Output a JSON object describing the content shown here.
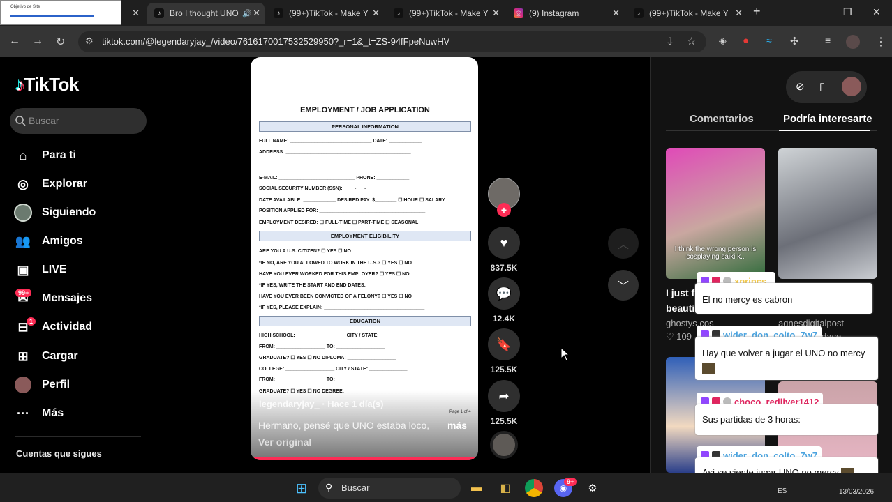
{
  "browser": {
    "tabs": [
      {
        "title": "Objetivo de Site",
        "favicon": "thumbnail-icon"
      },
      {
        "title": "Bro I thought UNO",
        "favicon": "tiktok-icon",
        "active": true
      },
      {
        "title": "(99+)TikTok - Make Y",
        "favicon": "tiktok-icon"
      },
      {
        "title": "(99+)TikTok - Make Y",
        "favicon": "tiktok-icon"
      },
      {
        "title": "(9) Instagram",
        "favicon": "instagram-icon"
      },
      {
        "title": "(99+)TikTok - Make Y",
        "favicon": "tiktok-icon"
      }
    ],
    "url": "tiktok.com/@legendaryjay_/video/7616170017532529950?_r=1&_t=ZS-94fFpeNuwHV"
  },
  "sidebar": {
    "logo": "TikTok",
    "search_placeholder": "Buscar",
    "items": [
      {
        "label": "Para ti",
        "icon": "home-icon"
      },
      {
        "label": "Explorar",
        "icon": "compass-icon"
      },
      {
        "label": "Siguiendo",
        "icon": "following-avatar-icon"
      },
      {
        "label": "Amigos",
        "icon": "friends-icon"
      },
      {
        "label": "LIVE",
        "icon": "live-icon"
      },
      {
        "label": "Mensajes",
        "icon": "messages-icon",
        "badge": "99+"
      },
      {
        "label": "Actividad",
        "icon": "activity-icon",
        "badge": "1"
      },
      {
        "label": "Cargar",
        "icon": "upload-icon"
      },
      {
        "label": "Perfil",
        "icon": "profile-avatar-icon"
      },
      {
        "label": "Más",
        "icon": "more-icon"
      }
    ],
    "following_heading": "Cuentas que sigues"
  },
  "video": {
    "document": {
      "title": "EMPLOYMENT / JOB APPLICATION",
      "sections": [
        {
          "heading": "PERSONAL INFORMATION",
          "lines": [
            "FULL NAME: ______________________________ DATE: ____________",
            "ADDRESS: ______________________________________________",
            "E-MAIL: ____________________________ PHONE: ____________",
            "SOCIAL SECURITY NUMBER (SSN): ____-___-____",
            "DATE AVAILABLE: ____________ DESIRED PAY: $________ ☐ HOUR ☐ SALARY",
            "POSITION APPLIED FOR: _______________________________________",
            "EMPLOYMENT DESIRED: ☐ FULL-TIME ☐ PART-TIME ☐ SEASONAL"
          ]
        },
        {
          "heading": "EMPLOYMENT ELIGIBILITY",
          "lines": [
            "ARE YOU A U.S. CITIZEN? ☐ YES ☐ NO",
            "*IF NO, ARE YOU ALLOWED TO WORK IN THE U.S.? ☐ YES ☐ NO",
            "HAVE YOU EVER WORKED FOR THIS EMPLOYER? ☐ YES ☐ NO",
            "*IF YES, WRITE THE START AND END DATES: ______________________",
            "HAVE YOU EVER BEEN CONVICTED OF A FELONY? ☐ YES ☐ NO",
            "*IF YES, PLEASE EXPLAIN: _____________________________________"
          ]
        },
        {
          "heading": "EDUCATION",
          "lines": [
            "HIGH SCHOOL: __________________ CITY / STATE: ______________",
            "FROM: __________________ TO: __________________",
            "GRADUATE? ☐ YES ☐ NO DIPLOMA: __________________",
            "COLLEGE: __________________ CITY / STATE: ______________",
            "FROM: __________________ TO: __________________",
            "GRADUATE? ☐ YES ☐ NO DEGREE: __________________"
          ]
        }
      ],
      "page": "Page 1 of 4"
    },
    "author": "legendaryjay_ · Hace 1 día(s)",
    "caption": "Hermano, pensé que UNO estaba loco,",
    "more_label": "más",
    "view_original": "Ver original",
    "progress": 1.0
  },
  "actions": {
    "likes": "837.5K",
    "comments": "12.4K",
    "saves": "125.5K",
    "shares": "125.5K"
  },
  "right_panel": {
    "tabs": [
      "Comentarios",
      "Podría interesarte"
    ],
    "active_tab": "Podría interesarte",
    "cards": [
      {
        "overlay": "I think the wrong person is cosplaying saiki k..",
        "title": "I just f",
        "title2": "beauti",
        "author": "ghostys.cos",
        "likes": "109"
      },
      {
        "title": "",
        "author": "agnesdigitalpost",
        "title2": "dace"
      }
    ]
  },
  "chat": [
    {
      "user": "xprincs_",
      "user_color": "#f2c94c",
      "message": "El no mercy es cabron"
    },
    {
      "user": "wider_don_colto_7w7",
      "user_color": "#4aa3df",
      "message": "Hay que volver a jugar el UNO no mercy"
    },
    {
      "user": "choco_redliver1412",
      "user_color": "#e0245e",
      "message": "Sus partidas de 3 horas:"
    },
    {
      "user": "wider_don_colto_7w7",
      "user_color": "#4aa3df",
      "message": "Asi se siente jugar UNO no mercy"
    }
  ],
  "taskbar": {
    "search_label": "Buscar",
    "lang": "ES",
    "date": "13/03/2026",
    "discord_badge": "9+"
  },
  "colors": {
    "accent": "#fe2c55",
    "background": "#000000"
  }
}
